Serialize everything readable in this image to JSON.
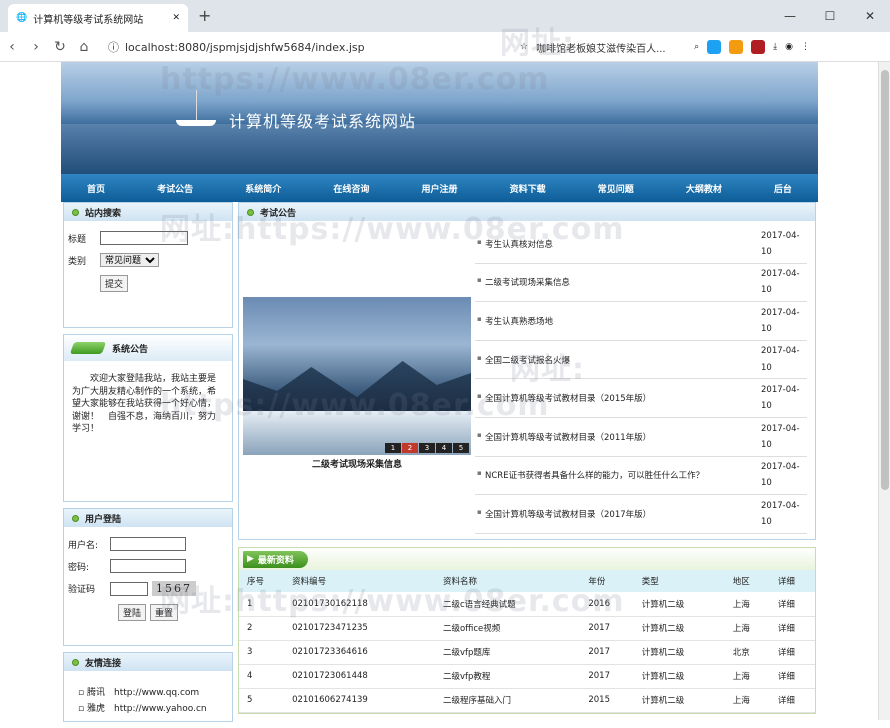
{
  "browser": {
    "tab_title": "计算机等级考试系统网站",
    "url": "localhost:8080/jspmjsjdjshfw5684/index.jsp",
    "bookmark_text": "咖啡馆老板娘艾滋传染百人..."
  },
  "site": {
    "title": "计算机等级考试系统网站",
    "menu": [
      "首页",
      "考试公告",
      "系统简介",
      "在线咨询",
      "用户注册",
      "资料下载",
      "常见问题",
      "大纲教材",
      "后台"
    ]
  },
  "search": {
    "heading": "站内搜索",
    "title_label": "标题",
    "type_label": "类别",
    "type_selected": "常见问题",
    "submit": "提交"
  },
  "announcement": {
    "heading": "系统公告",
    "text": "欢迎大家登陆我站，我站主要是为广大朋友精心制作的一个系统，希望大家能够在我站获得一个好心情，谢谢！　自强不息，海纳百川，努力学习！"
  },
  "login": {
    "heading": "用户登陆",
    "user_label": "用户名:",
    "pass_label": "密码:",
    "code_label": "验证码",
    "captcha": "1567",
    "login_btn": "登陆",
    "reset_btn": "重置"
  },
  "links": {
    "heading": "友情连接",
    "items": [
      {
        "name": "腾讯",
        "url": "http://www.qq.com"
      },
      {
        "name": "雅虎",
        "url": "http://www.yahoo.cn"
      }
    ]
  },
  "exam": {
    "heading": "考试公告",
    "caption": "二级考试现场采集信息",
    "pager": [
      "1",
      "2",
      "3",
      "4",
      "5"
    ],
    "active_page": 2,
    "news": [
      {
        "title": "考生认真核对信息",
        "date": "2017-04-10"
      },
      {
        "title": "二级考试现场采集信息",
        "date": "2017-04-10"
      },
      {
        "title": "考生认真熟悉场地",
        "date": "2017-04-10"
      },
      {
        "title": "全国二级考试报名火爆",
        "date": "2017-04-10"
      },
      {
        "title": "全国计算机等级考试教材目录（2015年版）",
        "date": "2017-04-10"
      },
      {
        "title": "全国计算机等级考试教材目录（2011年版）",
        "date": "2017-04-10"
      },
      {
        "title": "NCRE证书获得者具备什么样的能力，可以胜任什么工作？",
        "date": "2017-04-10"
      },
      {
        "title": "全国计算机等级考试教材目录（2017年版）",
        "date": "2017-04-10"
      }
    ]
  },
  "resources": {
    "heading": "最新资料",
    "columns": [
      "序号",
      "资料编号",
      "资料名称",
      "年份",
      "类型",
      "地区",
      "详细"
    ],
    "rows": [
      [
        "1",
        "02101730162118",
        "二级c语言经典试题",
        "2016",
        "计算机二级",
        "上海",
        "详细"
      ],
      [
        "2",
        "02101723471235",
        "二级office视频",
        "2017",
        "计算机二级",
        "上海",
        "详细"
      ],
      [
        "3",
        "02101723364616",
        "二级vfp题库",
        "2017",
        "计算机二级",
        "北京",
        "详细"
      ],
      [
        "4",
        "02101723061448",
        "二级vfp教程",
        "2017",
        "计算机二级",
        "上海",
        "详细"
      ],
      [
        "5",
        "02101606274139",
        "二级程序基础入门",
        "2015",
        "计算机二级",
        "上海",
        "详细"
      ]
    ]
  },
  "watermark": [
    "网址:",
    "https://www.08er.com",
    "网址:https://www.08er.com"
  ]
}
